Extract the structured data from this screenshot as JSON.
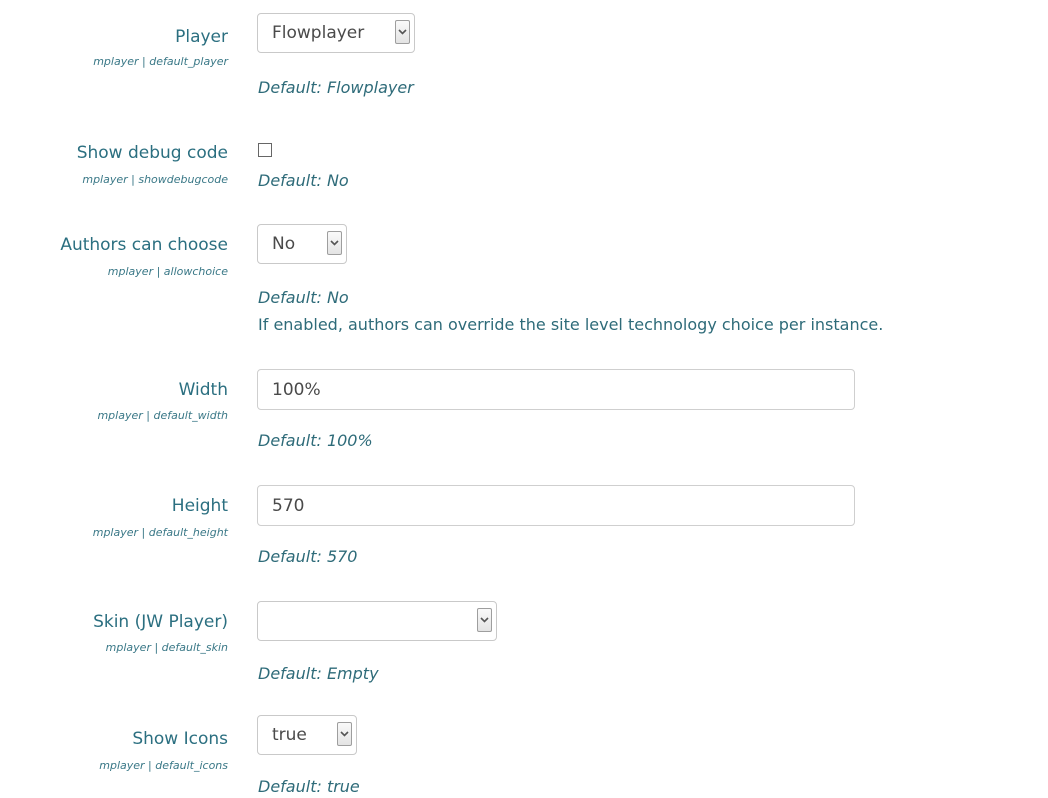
{
  "settings": [
    {
      "label": "Player",
      "key": "mplayer | default_player",
      "control": "select",
      "value": "Flowplayer",
      "default": "Default: Flowplayer"
    },
    {
      "label": "Show debug code",
      "key": "mplayer | showdebugcode",
      "control": "checkbox",
      "checked": false,
      "default": "Default: No"
    },
    {
      "label": "Authors can choose",
      "key": "mplayer | allowchoice",
      "control": "select",
      "value": "No",
      "default": "Default: No",
      "description": "If enabled, authors can override the site level technology choice per instance."
    },
    {
      "label": "Width",
      "key": "mplayer | default_width",
      "control": "text",
      "value": "100%",
      "default": "Default: 100%"
    },
    {
      "label": "Height",
      "key": "mplayer | default_height",
      "control": "text",
      "value": "570",
      "default": "Default: 570"
    },
    {
      "label": "Skin (JW Player)",
      "key": "mplayer | default_skin",
      "control": "select",
      "value": "",
      "default": "Default: Empty"
    },
    {
      "label": "Show Icons",
      "key": "mplayer | default_icons",
      "control": "select",
      "value": "true",
      "default": "Default: true"
    }
  ]
}
